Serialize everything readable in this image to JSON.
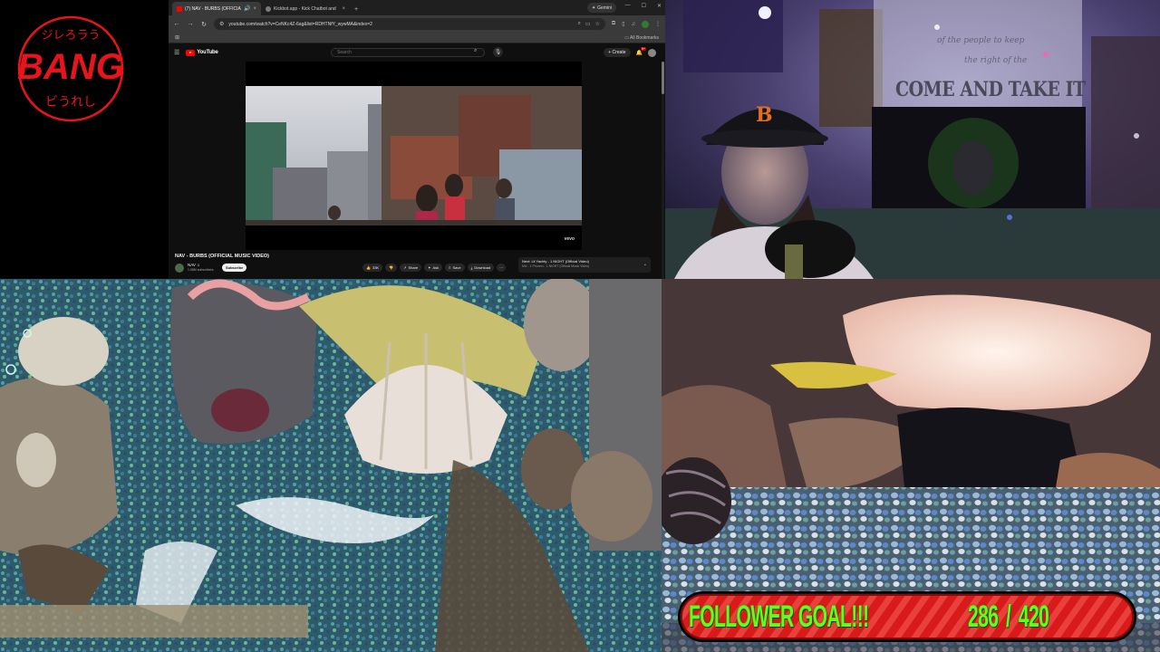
{
  "logo": {
    "text": "BANG",
    "top_script": "ジレろラう",
    "bottom_script": "ビうれし",
    "color": "#e8141c"
  },
  "browser": {
    "tabs": [
      {
        "label": "(7) NAV - BURBS (OFFICIAL",
        "icon": "youtube-favicon",
        "active": true
      },
      {
        "label": "Kickbot.app - Kick Chatbot and",
        "icon": "kick-favicon",
        "active": false
      }
    ],
    "gemini_label": "Gemini",
    "url": "youtube.com/watch?v=CeNKc4Z-6ag&list=RDHTNfY_wywMA&index=2",
    "all_bookmarks": "All Bookmarks"
  },
  "youtube": {
    "logo_text": "YouTube",
    "search_placeholder": "Search",
    "create_label": "+ Create",
    "notification_count": "9+",
    "watermark": "vevo",
    "video_title": "NAV - BURBS (OFFICIAL MUSIC VIDEO)",
    "channel_name": "NAV ♫",
    "subscribers": "1.08M subscribers",
    "subscribe_label": "Subscribe",
    "actions": [
      {
        "name": "like-button",
        "icon": "👍",
        "label": "33K"
      },
      {
        "name": "dislike-button",
        "icon": "👎",
        "label": ""
      },
      {
        "name": "share-button",
        "icon": "↗",
        "label": "Share"
      },
      {
        "name": "ask-button",
        "icon": "✦",
        "label": "Ask"
      },
      {
        "name": "save-button",
        "icon": "≡",
        "label": "Save"
      },
      {
        "name": "download-button",
        "icon": "⤓",
        "label": "Download"
      }
    ],
    "more_label": "···",
    "next_title": "Next: Lil Yachty - 1 NIGHT (Official Video)",
    "next_sub": "Mix - 1 Phunnn - 1 NIGHT (Official Music Video)"
  },
  "webcam": {
    "banner_text": "COME AND TAKE IT",
    "script_line_1": "of the people to keep",
    "script_line_2": "the right of the"
  },
  "follower_goal": {
    "label": "FOLLOWER GOAL!!!",
    "current": "286",
    "separator": "/",
    "target": "420",
    "text_color": "#5dff1f",
    "bar_color": "#d81a1a"
  }
}
